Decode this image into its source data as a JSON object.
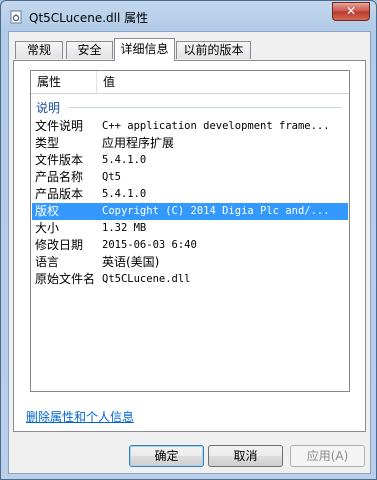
{
  "window": {
    "title": "Qt5CLucene.dll 属性",
    "close_label": "✕"
  },
  "tabs": [
    {
      "label": "常规"
    },
    {
      "label": "安全"
    },
    {
      "label": "详细信息"
    },
    {
      "label": "以前的版本"
    }
  ],
  "listview": {
    "col_property": "属性",
    "col_value": "值",
    "group_label": "说明",
    "rows": [
      {
        "key": "文件说明",
        "value": "C++ application development frame..."
      },
      {
        "key": "类型",
        "value": "应用程序扩展"
      },
      {
        "key": "文件版本",
        "value": "5.4.1.0"
      },
      {
        "key": "产品名称",
        "value": "Qt5"
      },
      {
        "key": "产品版本",
        "value": "5.4.1.0"
      },
      {
        "key": "版权",
        "value": "Copyright (C) 2014 Digia Plc and/..."
      },
      {
        "key": "大小",
        "value": "1.32 MB"
      },
      {
        "key": "修改日期",
        "value": "2015-06-03 6:40"
      },
      {
        "key": "语言",
        "value": "英语(美国)"
      },
      {
        "key": "原始文件名",
        "value": "Qt5CLucene.dll"
      }
    ]
  },
  "remove_link": "删除属性和个人信息",
  "buttons": {
    "ok": "确定",
    "cancel": "取消",
    "apply": "应用(A)"
  }
}
